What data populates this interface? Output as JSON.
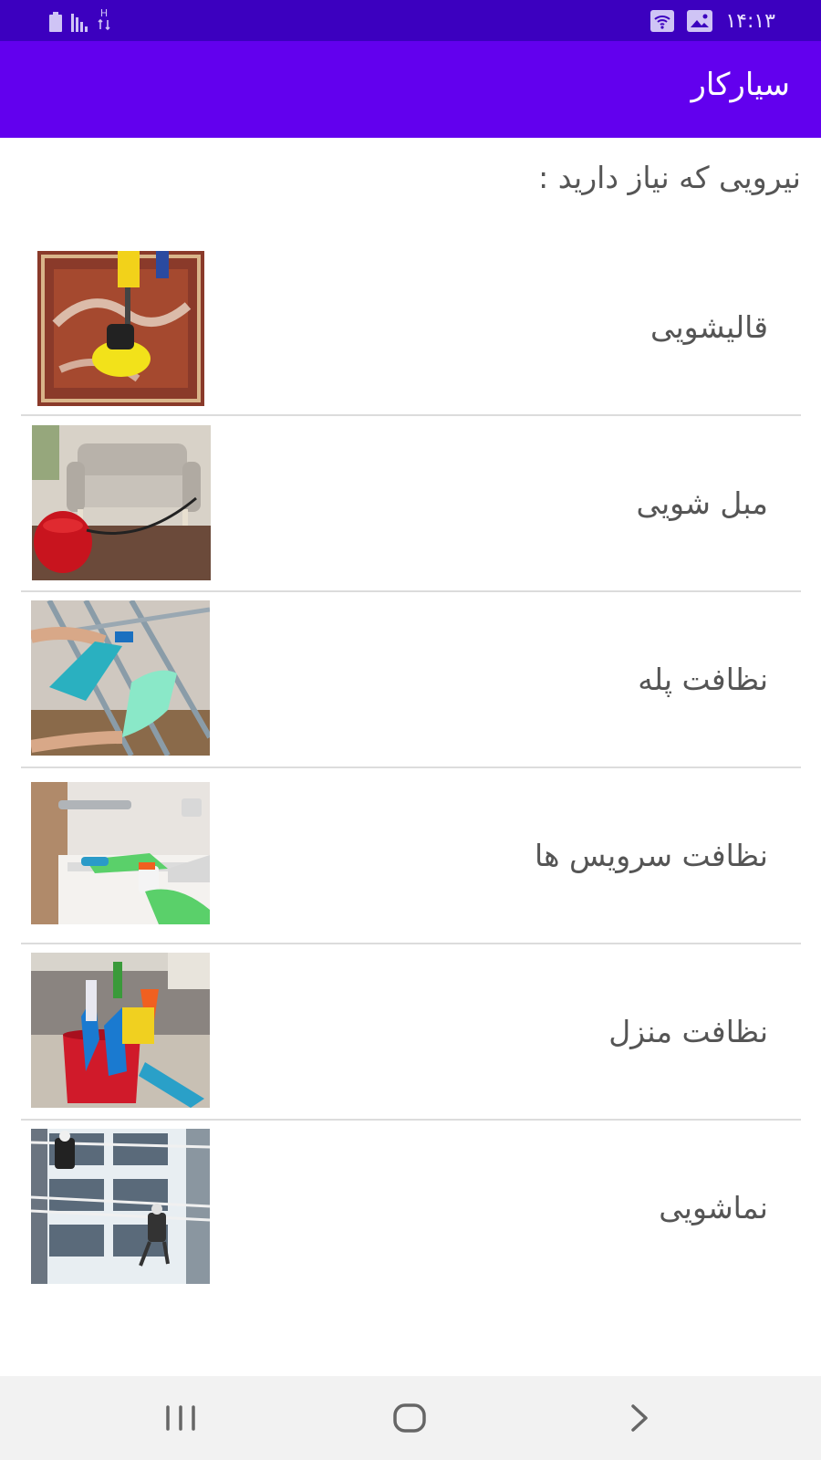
{
  "status_bar": {
    "time": "۱۴:۱۳",
    "net_type": "H",
    "icons": [
      "battery-icon",
      "signal-icon",
      "network-type-icon",
      "wifi-icon",
      "image-icon"
    ]
  },
  "app_bar": {
    "title": "سیارکار",
    "background": "#6200ee"
  },
  "prompt": "نیرویی که نیاز دارید :",
  "services": [
    {
      "label": "قالیشویی",
      "image": "carpet-washing-image"
    },
    {
      "label": "مبل شویی",
      "image": "sofa-washing-image"
    },
    {
      "label": "نظافت پله",
      "image": "stair-cleaning-image"
    },
    {
      "label": "نظافت سرویس ها",
      "image": "bathroom-cleaning-image"
    },
    {
      "label": "نظافت منزل",
      "image": "house-cleaning-image"
    },
    {
      "label": "نماشویی",
      "image": "facade-washing-image"
    }
  ],
  "nav_bar": {
    "icons": [
      "recent-apps-icon",
      "home-icon",
      "back-icon"
    ]
  },
  "colors": {
    "status_bar": "#3c00bf",
    "app_bar": "#6200ee",
    "text": "#555555",
    "divider": "#dcdcdc"
  }
}
